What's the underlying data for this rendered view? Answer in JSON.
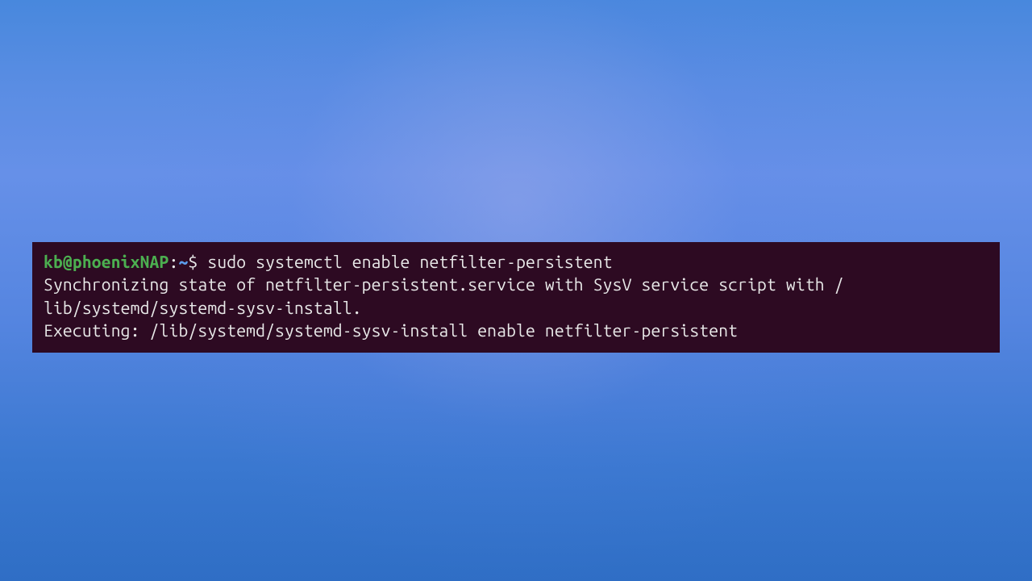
{
  "terminal": {
    "prompt": {
      "user_host": "kb@phoenixNAP",
      "colon": ":",
      "path": "~",
      "symbol": "$"
    },
    "command": "sudo systemctl enable netfilter-persistent",
    "output_line1": "Synchronizing state of netfilter-persistent.service with SysV service script with /",
    "output_line2": "lib/systemd/systemd-sysv-install.",
    "output_line3": "Executing: /lib/systemd/systemd-sysv-install enable netfilter-persistent"
  }
}
